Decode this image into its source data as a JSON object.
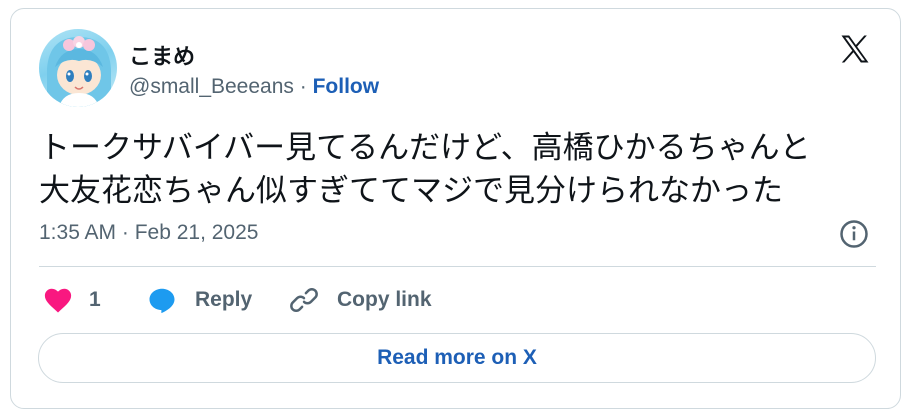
{
  "author": {
    "display_name": "こまめ",
    "handle": "@small_Beeeans",
    "separator": " · ",
    "follow_label": "Follow",
    "avatar_icon": "anime-character-avatar"
  },
  "tweet": {
    "text_lines": [
      "トークサバイバー見てるんだけど、高橋ひかるちゃんと",
      "大友花恋ちゃん似すぎててマジで見分けられなかった"
    ],
    "timestamp": "1:35 AM · Feb 21, 2025"
  },
  "actions": {
    "like_count": "1",
    "reply_label": "Reply",
    "copy_link_label": "Copy link"
  },
  "footer": {
    "read_more_label": "Read more on X"
  },
  "colors": {
    "heart": "#f91880",
    "reply_bubble": "#1d9bf0",
    "link": "#1d5fb6",
    "text": "#0f1419",
    "muted": "#536471",
    "border": "#cfd9de"
  },
  "icons": {
    "brand": "x-logo-icon",
    "info": "info-icon",
    "like": "heart-icon",
    "reply": "reply-bubble-icon",
    "copy": "link-icon"
  }
}
